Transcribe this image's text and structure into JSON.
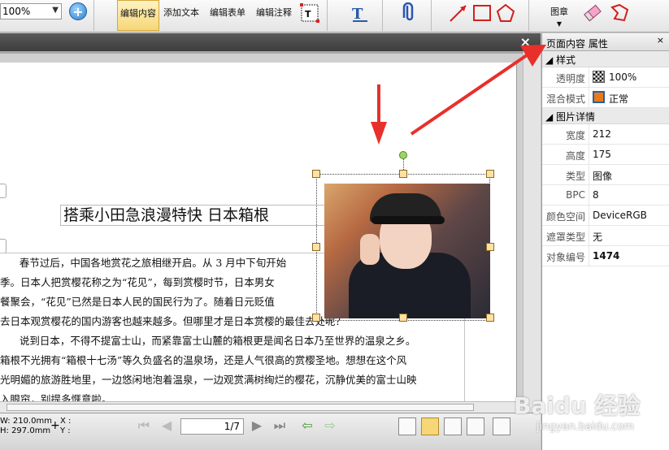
{
  "toolbar": {
    "zoom_value": "100%",
    "buttons": {
      "edit_content": "编辑内容",
      "add_text": "添加文本",
      "edit_form": "编辑表单",
      "edit_annotation": "编辑注释",
      "stamp": "图章"
    },
    "icons": [
      "zoom-in-icon",
      "text-box-icon",
      "text-format-icon",
      "paperclip-icon",
      "line-icon",
      "rectangle-icon",
      "pentagon-icon",
      "stamp-icon",
      "eraser-icon",
      "polygon-icon"
    ]
  },
  "document": {
    "title": "搭乘小田急浪漫特快  日本箱根",
    "paragraphs": [
      "      春节过后，中国各地赏花之旅相继开启。从 3 月中下旬开始",
      "季。日本人把赏樱花称之为“花见”，每到赏樱时节，日本男女",
      "餐聚会，“花见”已然是日本人民的国民行为了。随着日元贬值",
      "去日本观赏樱花的国内游客也越来越多。但哪里才是日本赏樱的最佳去处呢？",
      "",
      "      说到日本，不得不提富士山，而紧靠富士山麓的箱根更是闻名日本乃至世界的温泉之乡。",
      "箱根不光拥有“箱根十七汤”等久负盛名的温泉场，还是人气很高的赏樱圣地。想想在这个风",
      "光明媚的旅游胜地里，一边悠闲地泡着温泉，一边观赏满树绚烂的樱花，沉静优美的富士山映",
      "入眼帘，别提多惬意啦。"
    ]
  },
  "properties": {
    "header": "页面内容 属性",
    "sections": {
      "style": "样式",
      "image_details": "图片详情"
    },
    "style_rows": [
      {
        "key": "透明度",
        "value": "100%"
      },
      {
        "key": "混合模式",
        "value": "正常"
      }
    ],
    "detail_rows": [
      {
        "key": "宽度",
        "value": "212"
      },
      {
        "key": "高度",
        "value": "175"
      },
      {
        "key": "类型",
        "value": "图像"
      },
      {
        "key": "BPC",
        "value": "8"
      },
      {
        "key": "颜色空间",
        "value": "DeviceRGB"
      },
      {
        "key": "遮罩类型",
        "value": "无"
      },
      {
        "key": "对象编号",
        "value": "1474"
      }
    ]
  },
  "statusbar": {
    "width": "W: 210.0mm",
    "height": "H: 297.0mm",
    "x_label": "X :",
    "y_label": "Y :",
    "page": "1/7"
  },
  "watermark": {
    "brand": "Baidu 经验",
    "url": "jingyan.baidu.com"
  },
  "colors": {
    "active_button": "#f6d777",
    "annotation_arrow": "#e8302b",
    "handle": "#ffe2a3"
  }
}
